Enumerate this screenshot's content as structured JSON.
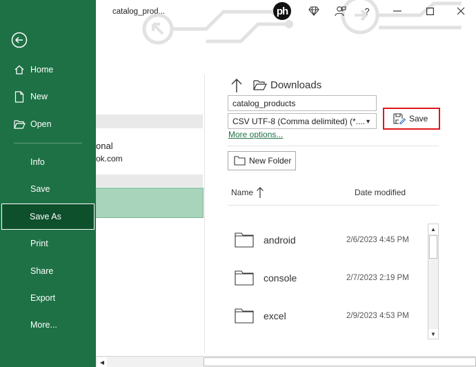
{
  "window": {
    "doc_title": "catalog_prod..."
  },
  "titlebar": {
    "logo_text": "ph",
    "help": "?"
  },
  "nav": {
    "home": "Home",
    "new": "New",
    "open": "Open",
    "info": "Info",
    "save": "Save",
    "save_as": "Save As",
    "print": "Print",
    "share": "Share",
    "export": "Export",
    "more": "More..."
  },
  "locations": {
    "line1": "onal",
    "line2": "ok.com"
  },
  "save_panel": {
    "breadcrumb": "Downloads",
    "filename": "catalog_products",
    "filetype": "CSV UTF-8 (Comma delimited) (*....",
    "more_options": "More options...",
    "save_button": "Save",
    "new_folder_button": "New Folder"
  },
  "file_list": {
    "col_name": "Name",
    "col_date": "Date modified",
    "rows": [
      {
        "name": "android",
        "date": "2/6/2023 4:45 PM"
      },
      {
        "name": "console",
        "date": "2/7/2023 2:19 PM"
      },
      {
        "name": "excel",
        "date": "2/9/2023 4:53 PM"
      }
    ]
  },
  "colors": {
    "nav_bg": "#1e7145",
    "nav_selected": "#0e4f2c",
    "highlight": "#e0161b",
    "link": "#1e7145",
    "location_selected": "#a7d4bb"
  }
}
